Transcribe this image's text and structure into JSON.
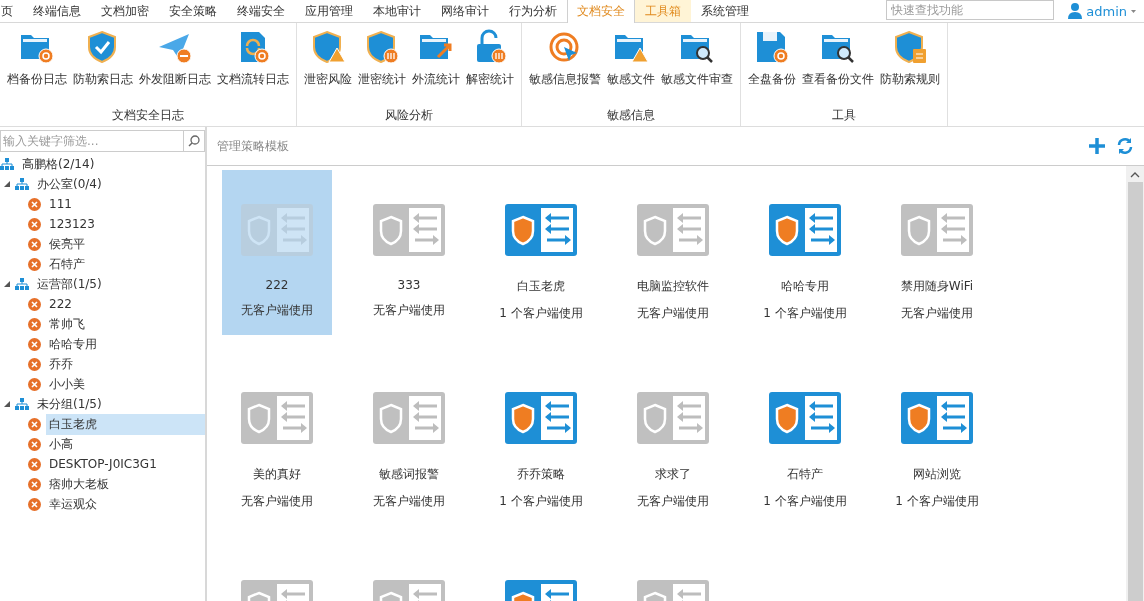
{
  "menu_tabs": [
    {
      "label": "页",
      "selected": false,
      "hovered": false
    },
    {
      "label": "终端信息",
      "selected": false,
      "hovered": false
    },
    {
      "label": "文档加密",
      "selected": false,
      "hovered": false
    },
    {
      "label": "安全策略",
      "selected": false,
      "hovered": false
    },
    {
      "label": "终端安全",
      "selected": false,
      "hovered": false
    },
    {
      "label": "应用管理",
      "selected": false,
      "hovered": false
    },
    {
      "label": "本地审计",
      "selected": false,
      "hovered": false
    },
    {
      "label": "网络审计",
      "selected": false,
      "hovered": false
    },
    {
      "label": "行为分析",
      "selected": false,
      "hovered": false
    },
    {
      "label": "文档安全",
      "selected": true,
      "hovered": false
    },
    {
      "label": "工具箱",
      "selected": false,
      "hovered": true
    },
    {
      "label": "系统管理",
      "selected": false,
      "hovered": false
    }
  ],
  "quick_search": {
    "placeholder": "快速查找功能"
  },
  "user": {
    "name": "admin"
  },
  "ribbon_groups": [
    {
      "label": "文档安全日志",
      "items": [
        {
          "label": "档备份日志",
          "kind": "foldersync"
        },
        {
          "label": "防勒索日志",
          "kind": "shieldcheck"
        },
        {
          "label": "外发阻断日志",
          "kind": "planeminus"
        },
        {
          "label": "文档流转日志",
          "kind": "docsync"
        }
      ]
    },
    {
      "label": "风险分析",
      "items": [
        {
          "label": "泄密风险",
          "kind": "shieldwarn"
        },
        {
          "label": "泄密统计",
          "kind": "shieldstats"
        },
        {
          "label": "外流统计",
          "kind": "folderarrow"
        },
        {
          "label": "解密统计",
          "kind": "lockstats"
        }
      ]
    },
    {
      "label": "敏感信息",
      "items": [
        {
          "label": "敏感信息报警",
          "kind": "target"
        },
        {
          "label": "敏感文件",
          "kind": "folderwarn"
        },
        {
          "label": "敏感文件审查",
          "kind": "foldersearch"
        }
      ]
    },
    {
      "label": "工具",
      "items": [
        {
          "label": "全盘备份",
          "kind": "disksync"
        },
        {
          "label": "查看备份文件",
          "kind": "foldersearch"
        },
        {
          "label": "防勒索规则",
          "kind": "shieldlist"
        }
      ]
    }
  ],
  "tree_filter": {
    "placeholder": "输入关键字筛选..."
  },
  "tree": {
    "label": "高鹏格(2/14)",
    "kind": "group",
    "children": [
      {
        "label": "办公室(0/4)",
        "kind": "group",
        "expanded": true,
        "children": [
          {
            "label": "111",
            "kind": "client",
            "selected": false
          },
          {
            "label": "123123",
            "kind": "client",
            "selected": false
          },
          {
            "label": "侯亮平",
            "kind": "client",
            "selected": false
          },
          {
            "label": "石特产",
            "kind": "client",
            "selected": false
          }
        ]
      },
      {
        "label": "运营部(1/5)",
        "kind": "group",
        "expanded": true,
        "children": [
          {
            "label": "222",
            "kind": "client",
            "selected": false
          },
          {
            "label": "常帅飞",
            "kind": "client",
            "selected": false
          },
          {
            "label": "哈哈专用",
            "kind": "client",
            "selected": false
          },
          {
            "label": "乔乔",
            "kind": "client",
            "selected": false
          },
          {
            "label": "小小美",
            "kind": "client",
            "selected": false
          }
        ]
      },
      {
        "label": "未分组(1/5)",
        "kind": "group",
        "expanded": true,
        "children": [
          {
            "label": "白玉老虎",
            "kind": "client",
            "selected": true
          },
          {
            "label": "小高",
            "kind": "client",
            "selected": false
          },
          {
            "label": "DESKTOP-J0IC3G1",
            "kind": "client",
            "selected": false
          },
          {
            "label": "痞帅大老板",
            "kind": "client",
            "selected": false
          },
          {
            "label": "幸运观众",
            "kind": "client",
            "selected": false
          }
        ]
      }
    ]
  },
  "templates_panel": {
    "title": "管理策略模板"
  },
  "templates": [
    {
      "name": "222",
      "usage": "无客户端使用",
      "active": false,
      "selected": true
    },
    {
      "name": "333",
      "usage": "无客户端使用",
      "active": false,
      "selected": false
    },
    {
      "name": "白玉老虎",
      "usage": "1 个客户端使用",
      "active": true,
      "selected": false
    },
    {
      "name": "电脑监控软件",
      "usage": "无客户端使用",
      "active": false,
      "selected": false
    },
    {
      "name": "哈哈专用",
      "usage": "1 个客户端使用",
      "active": true,
      "selected": false
    },
    {
      "name": "禁用随身WiFi",
      "usage": "无客户端使用",
      "active": false,
      "selected": false
    },
    {
      "name": "美的真好",
      "usage": "无客户端使用",
      "active": false,
      "selected": false
    },
    {
      "name": "敏感词报警",
      "usage": "无客户端使用",
      "active": false,
      "selected": false
    },
    {
      "name": "乔乔策略",
      "usage": "1 个客户端使用",
      "active": true,
      "selected": false
    },
    {
      "name": "求求了",
      "usage": "无客户端使用",
      "active": false,
      "selected": false
    },
    {
      "name": "石特产",
      "usage": "1 个客户端使用",
      "active": true,
      "selected": false
    },
    {
      "name": "网站浏览",
      "usage": "1 个客户端使用",
      "active": true,
      "selected": false
    },
    {
      "active": false,
      "selected": false
    },
    {
      "active": false,
      "selected": false
    },
    {
      "active": true,
      "selected": false
    },
    {
      "active": false,
      "selected": false
    }
  ]
}
